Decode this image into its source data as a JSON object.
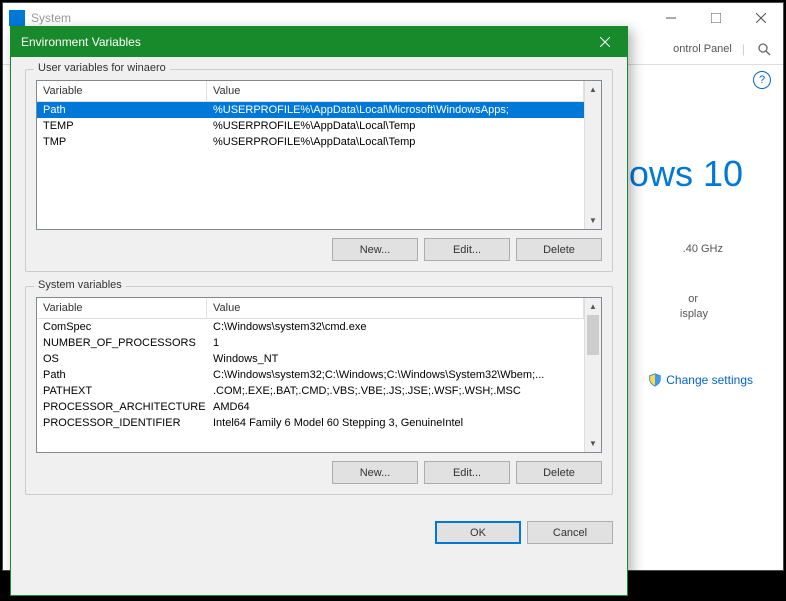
{
  "bg": {
    "title": "System",
    "toolbar_text": "ontrol Panel",
    "logo_text": "ows 10",
    "spec": ".40 GHz",
    "spec2": "or",
    "spec3": "isplay",
    "change_settings": "Change settings"
  },
  "dialog": {
    "title": "Environment Variables",
    "user_group_label": "User variables for winaero",
    "system_group_label": "System variables",
    "col_variable": "Variable",
    "col_value": "Value",
    "buttons": {
      "new": "New...",
      "edit": "Edit...",
      "delete": "Delete",
      "ok": "OK",
      "cancel": "Cancel"
    }
  },
  "user_vars": [
    {
      "name": "Path",
      "value": "%USERPROFILE%\\AppData\\Local\\Microsoft\\WindowsApps;",
      "selected": true
    },
    {
      "name": "TEMP",
      "value": "%USERPROFILE%\\AppData\\Local\\Temp",
      "selected": false
    },
    {
      "name": "TMP",
      "value": "%USERPROFILE%\\AppData\\Local\\Temp",
      "selected": false
    }
  ],
  "system_vars": [
    {
      "name": "ComSpec",
      "value": "C:\\Windows\\system32\\cmd.exe"
    },
    {
      "name": "NUMBER_OF_PROCESSORS",
      "value": "1"
    },
    {
      "name": "OS",
      "value": "Windows_NT"
    },
    {
      "name": "Path",
      "value": "C:\\Windows\\system32;C:\\Windows;C:\\Windows\\System32\\Wbem;..."
    },
    {
      "name": "PATHEXT",
      "value": ".COM;.EXE;.BAT;.CMD;.VBS;.VBE;.JS;.JSE;.WSF;.WSH;.MSC"
    },
    {
      "name": "PROCESSOR_ARCHITECTURE",
      "value": "AMD64"
    },
    {
      "name": "PROCESSOR_IDENTIFIER",
      "value": "Intel64 Family 6 Model 60 Stepping 3, GenuineIntel"
    }
  ]
}
